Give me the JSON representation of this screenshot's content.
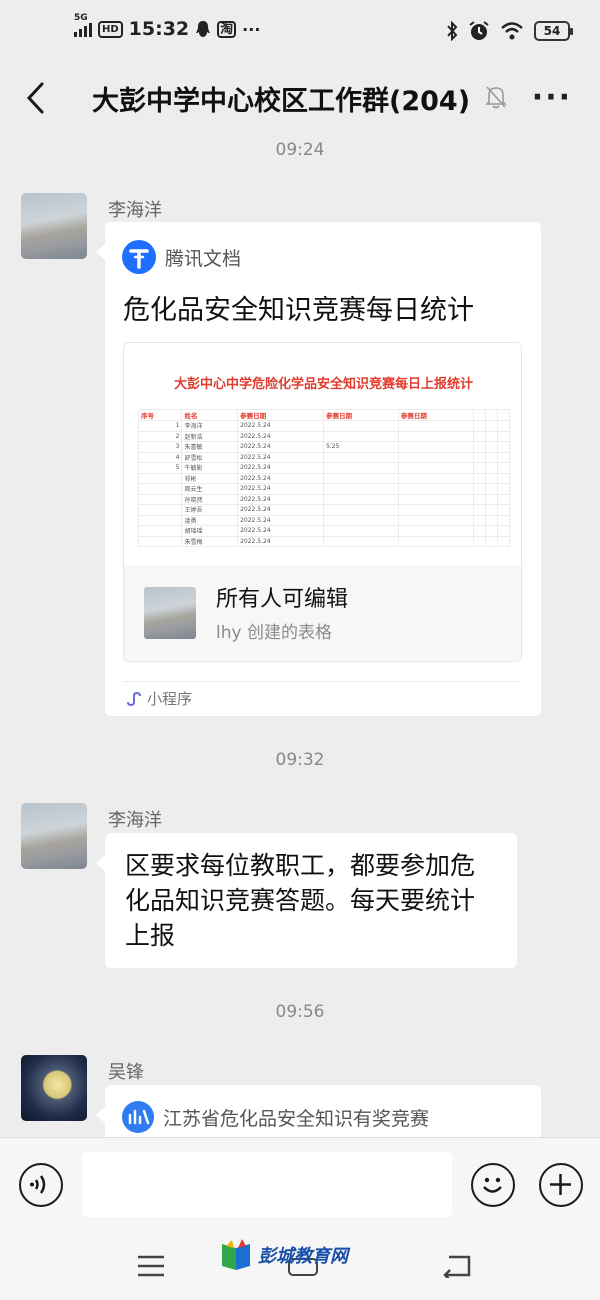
{
  "status_bar": {
    "network": "5G",
    "hd": "HD",
    "time": "15:32",
    "taobao": "淘",
    "dots": "···",
    "battery": "54"
  },
  "header": {
    "title": "大彭中学中心校区工作群(204)",
    "more": "···"
  },
  "messages": {
    "time1": "09:24",
    "sender1": "李海洋",
    "card": {
      "app_name": "腾讯文档",
      "title": "危化品安全知识竞赛每日统计",
      "sheet_title": "大彭中心中学危险化学品安全知识竞赛每日上报统计",
      "sheet_headers": [
        "序号",
        "姓名",
        "参赛日期",
        "参赛日期",
        "参赛日期"
      ],
      "sheet_rows": [
        [
          "1",
          "李海洋",
          "2022.5.24",
          "",
          ""
        ],
        [
          "2",
          "赵新浩",
          "2022.5.24",
          "",
          ""
        ],
        [
          "3",
          "朱喜敏",
          "2022.5.24",
          "5.25",
          ""
        ],
        [
          "4",
          "舒雪松",
          "2022.5.24",
          "",
          ""
        ],
        [
          "5",
          "牛毓影",
          "2022.5.24",
          "",
          ""
        ],
        [
          "",
          "祁彬",
          "2022.5.24",
          "",
          ""
        ],
        [
          "",
          "周云生",
          "2022.5.24",
          "",
          ""
        ],
        [
          "",
          "孙晓然",
          "2022.5.24",
          "",
          ""
        ],
        [
          "",
          "王婷吾",
          "2022.5.24",
          "",
          ""
        ],
        [
          "",
          "凌勇",
          "2022.5.24",
          "",
          ""
        ],
        [
          "",
          "胡瑶瑶",
          "2022.5.24",
          "",
          ""
        ],
        [
          "",
          "朱雪梅",
          "2022.5.24",
          "",
          ""
        ]
      ],
      "permission": "所有人可编辑",
      "creator": "lhy 创建的表格",
      "mini_program": "小程序"
    },
    "time2": "09:32",
    "sender2": "李海洋",
    "text2": "区要求每位教职工，都要参加危化品知识竞赛答题。每天要统计上报",
    "time3": "09:56",
    "sender3": "吴锋",
    "card2_title": "江苏省危化品安全知识有奖竞赛"
  },
  "watermark": "彭城教育网",
  "colors": {
    "background": "#ededed",
    "bubble": "#ffffff",
    "tencent_docs_blue": "#1e6fff",
    "sheet_red": "#e23b2e"
  },
  "icons": {
    "back": "chevron-left-icon",
    "mute": "bell-off-icon",
    "voice": "voice-icon",
    "emoji": "smile-icon",
    "plus": "plus-icon"
  }
}
